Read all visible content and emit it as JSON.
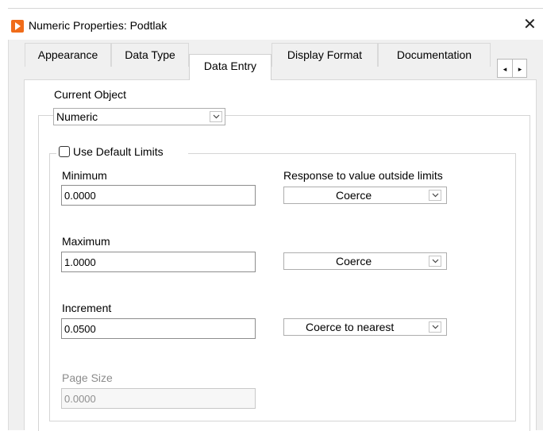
{
  "window": {
    "title": "Numeric Properties: Podtlak",
    "close_glyph": "✕",
    "icon": "labview-icon"
  },
  "tabs": [
    {
      "label": "Appearance",
      "active": false
    },
    {
      "label": "Data Type",
      "active": false
    },
    {
      "label": "Data Entry",
      "active": true
    },
    {
      "label": "Display Format",
      "active": false
    },
    {
      "label": "Documentation",
      "active": false
    }
  ],
  "tab_scroll": {
    "left": "◂",
    "right": "▸"
  },
  "current_object": {
    "label": "Current Object",
    "value": "Numeric"
  },
  "limits": {
    "use_default_label": "Use Default Limits",
    "use_default_checked": false,
    "response_label": "Response to value outside limits",
    "minimum": {
      "label": "Minimum",
      "value": "0.0000",
      "response": "Coerce"
    },
    "maximum": {
      "label": "Maximum",
      "value": "1.0000",
      "response": "Coerce"
    },
    "increment": {
      "label": "Increment",
      "value": "0.0500",
      "response": "Coerce to nearest"
    },
    "page_size": {
      "label": "Page Size",
      "value": "0.0000",
      "disabled": true
    }
  },
  "colors": {
    "app_icon": "#f06c1a",
    "dialog_bg": "#f0f0f0",
    "panel_bg": "#ffffff",
    "disabled_text": "#8c8c8c"
  }
}
